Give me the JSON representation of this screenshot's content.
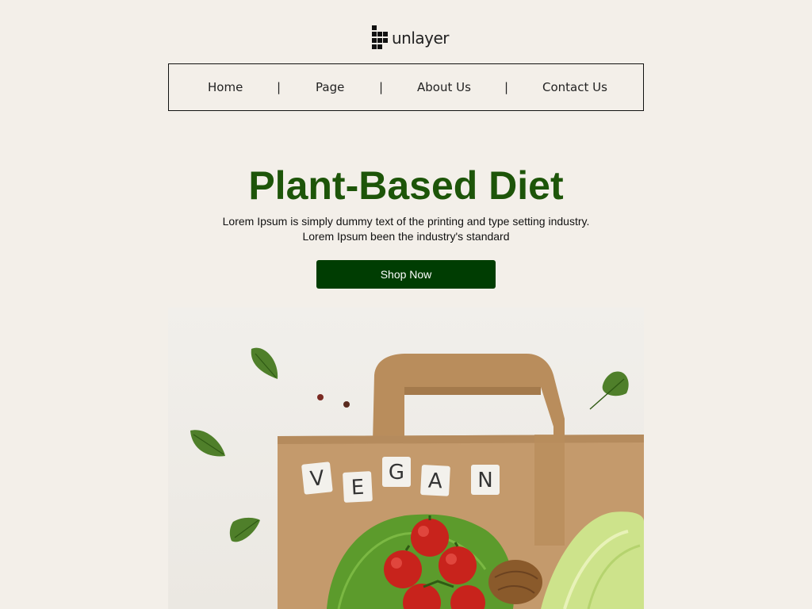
{
  "brand": {
    "name": "unlayer"
  },
  "nav": {
    "items": [
      {
        "label": "Home"
      },
      {
        "label": "Page"
      },
      {
        "label": "About Us"
      },
      {
        "label": "Contact Us"
      }
    ],
    "separator": "|"
  },
  "hero": {
    "title": "Plant-Based Diet",
    "description_line1": "Lorem Ipsum is simply dummy text of the printing and type setting industry.",
    "description_line2": "Lorem Ipsum been the industry's standard",
    "cta_label": "Shop Now"
  },
  "hero_image": {
    "tile_letters": [
      "V",
      "E",
      "G",
      "A",
      "N"
    ]
  },
  "colors": {
    "background": "#f3efe9",
    "title": "#1d5509",
    "button": "#003d02",
    "button_text": "#ffffff"
  }
}
